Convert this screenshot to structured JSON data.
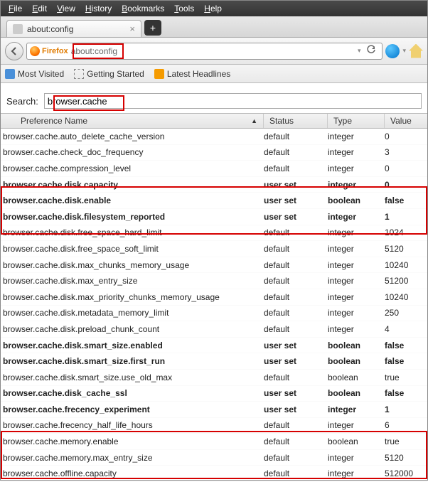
{
  "menu": {
    "items": [
      "File",
      "Edit",
      "View",
      "History",
      "Bookmarks",
      "Tools",
      "Help"
    ]
  },
  "tab": {
    "title": "about:config"
  },
  "url": {
    "brand": "Firefox",
    "value": "about:config"
  },
  "bookmarks": [
    {
      "label": "Most Visited"
    },
    {
      "label": "Getting Started"
    },
    {
      "label": "Latest Headlines"
    }
  ],
  "search": {
    "label": "Search:",
    "value": "browser.cache"
  },
  "columns": {
    "name": "Preference Name",
    "status": "Status",
    "type": "Type",
    "value": "Value"
  },
  "prefs": [
    {
      "name": "browser.cache.auto_delete_cache_version",
      "status": "default",
      "type": "integer",
      "value": "0",
      "bold": false
    },
    {
      "name": "browser.cache.check_doc_frequency",
      "status": "default",
      "type": "integer",
      "value": "3",
      "bold": false
    },
    {
      "name": "browser.cache.compression_level",
      "status": "default",
      "type": "integer",
      "value": "0",
      "bold": false
    },
    {
      "name": "browser.cache.disk.capacity",
      "status": "user set",
      "type": "integer",
      "value": "0",
      "bold": true
    },
    {
      "name": "browser.cache.disk.enable",
      "status": "user set",
      "type": "boolean",
      "value": "false",
      "bold": true
    },
    {
      "name": "browser.cache.disk.filesystem_reported",
      "status": "user set",
      "type": "integer",
      "value": "1",
      "bold": true
    },
    {
      "name": "browser.cache.disk.free_space_hard_limit",
      "status": "default",
      "type": "integer",
      "value": "1024",
      "bold": false
    },
    {
      "name": "browser.cache.disk.free_space_soft_limit",
      "status": "default",
      "type": "integer",
      "value": "5120",
      "bold": false
    },
    {
      "name": "browser.cache.disk.max_chunks_memory_usage",
      "status": "default",
      "type": "integer",
      "value": "10240",
      "bold": false
    },
    {
      "name": "browser.cache.disk.max_entry_size",
      "status": "default",
      "type": "integer",
      "value": "51200",
      "bold": false
    },
    {
      "name": "browser.cache.disk.max_priority_chunks_memory_usage",
      "status": "default",
      "type": "integer",
      "value": "10240",
      "bold": false
    },
    {
      "name": "browser.cache.disk.metadata_memory_limit",
      "status": "default",
      "type": "integer",
      "value": "250",
      "bold": false
    },
    {
      "name": "browser.cache.disk.preload_chunk_count",
      "status": "default",
      "type": "integer",
      "value": "4",
      "bold": false
    },
    {
      "name": "browser.cache.disk.smart_size.enabled",
      "status": "user set",
      "type": "boolean",
      "value": "false",
      "bold": true
    },
    {
      "name": "browser.cache.disk.smart_size.first_run",
      "status": "user set",
      "type": "boolean",
      "value": "false",
      "bold": true
    },
    {
      "name": "browser.cache.disk.smart_size.use_old_max",
      "status": "default",
      "type": "boolean",
      "value": "true",
      "bold": false
    },
    {
      "name": "browser.cache.disk_cache_ssl",
      "status": "user set",
      "type": "boolean",
      "value": "false",
      "bold": true
    },
    {
      "name": "browser.cache.frecency_experiment",
      "status": "user set",
      "type": "integer",
      "value": "1",
      "bold": true
    },
    {
      "name": "browser.cache.frecency_half_life_hours",
      "status": "default",
      "type": "integer",
      "value": "6",
      "bold": false
    },
    {
      "name": "browser.cache.memory.enable",
      "status": "default",
      "type": "boolean",
      "value": "true",
      "bold": false
    },
    {
      "name": "browser.cache.memory.max_entry_size",
      "status": "default",
      "type": "integer",
      "value": "5120",
      "bold": false
    },
    {
      "name": "browser.cache.offline.capacity",
      "status": "default",
      "type": "integer",
      "value": "512000",
      "bold": false
    }
  ]
}
